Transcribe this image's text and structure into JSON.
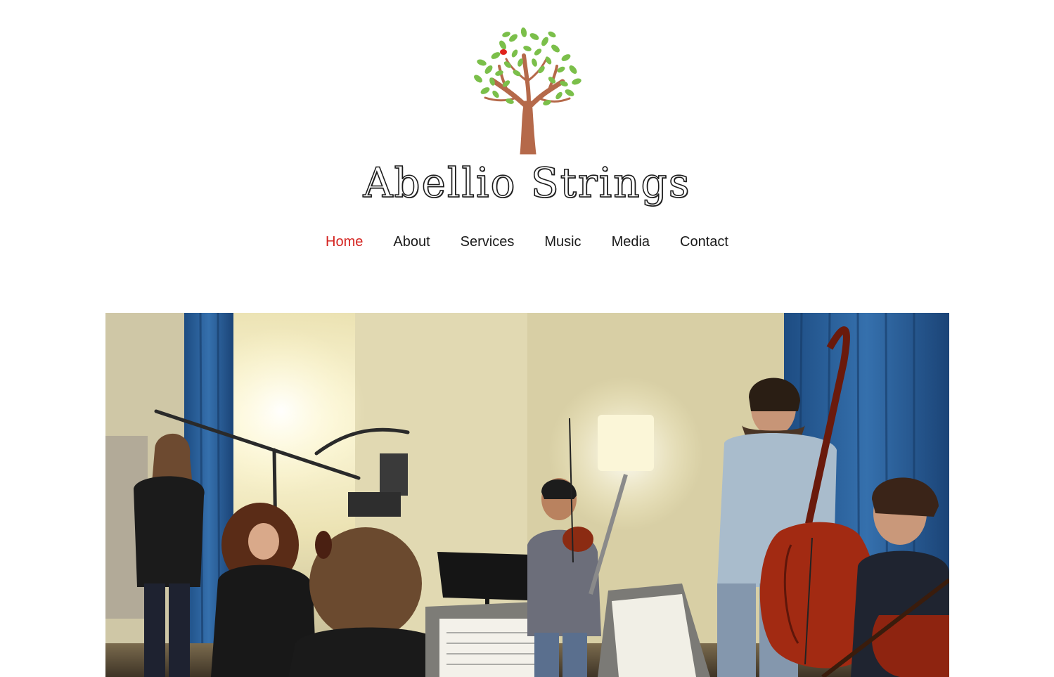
{
  "brand": {
    "name": "Abellio Strings",
    "colors": {
      "leaf": "#7bbf4a",
      "trunk": "#b5694a",
      "bird": "#e0221b",
      "nav_active": "#d4231f",
      "nav_text": "#1a1a1a"
    }
  },
  "nav": {
    "items": [
      {
        "label": "Home",
        "active": true
      },
      {
        "label": "About",
        "active": false
      },
      {
        "label": "Services",
        "active": false
      },
      {
        "label": "Music",
        "active": false
      },
      {
        "label": "Media",
        "active": false
      },
      {
        "label": "Contact",
        "active": false
      }
    ]
  },
  "hero": {
    "icon": "rehearsal-photo"
  }
}
